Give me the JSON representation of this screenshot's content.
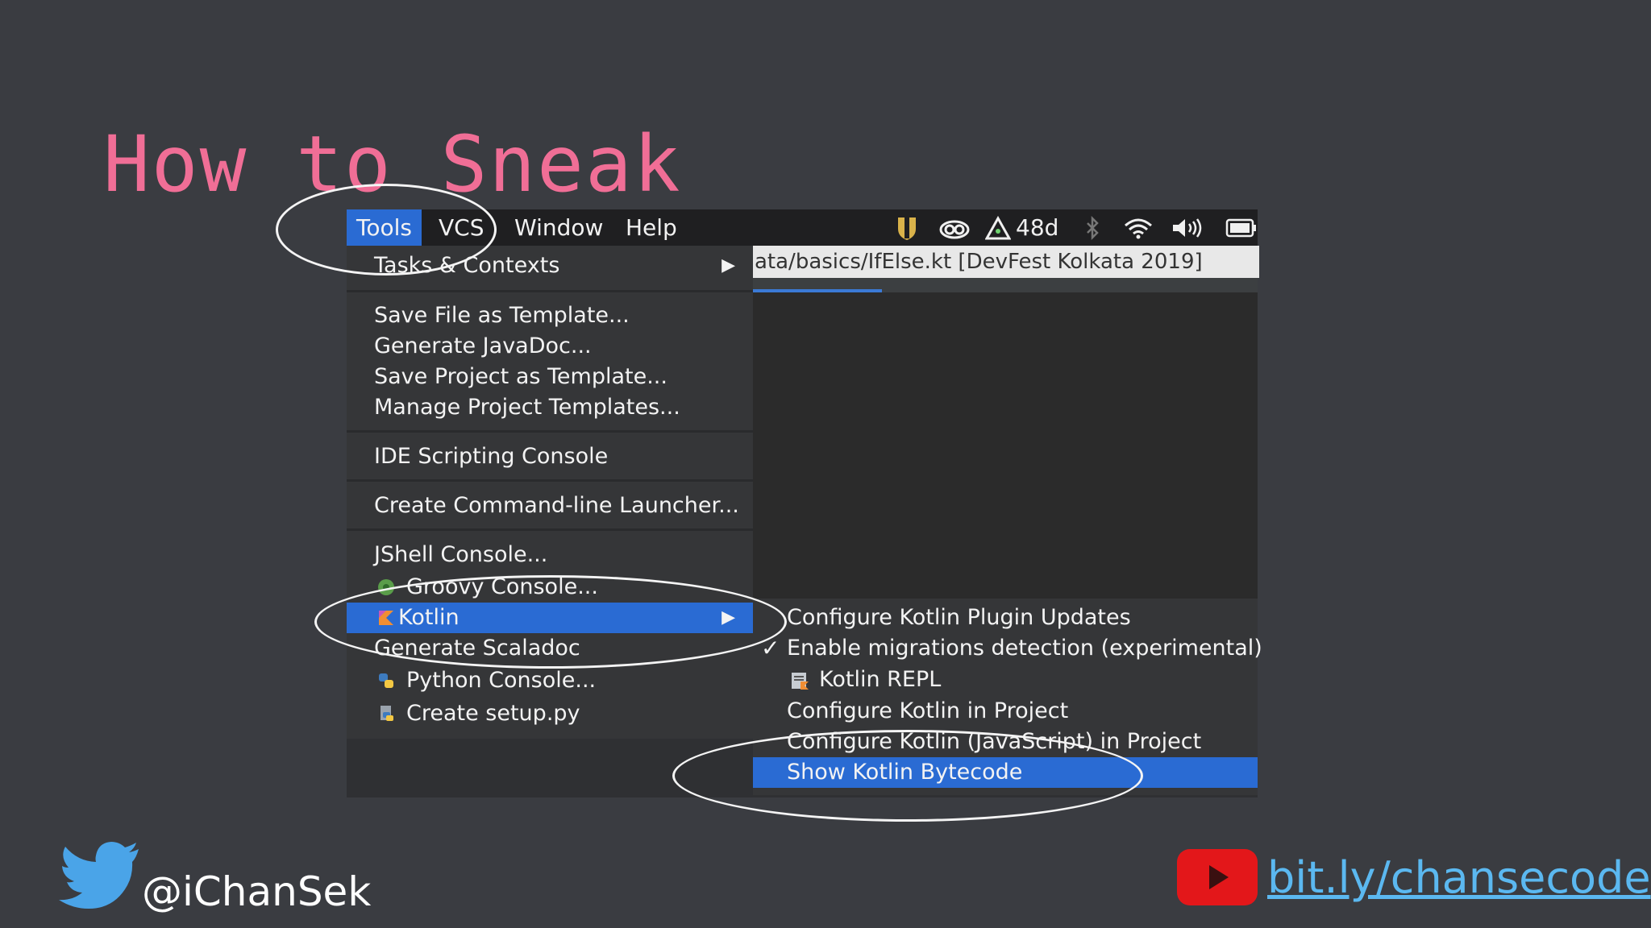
{
  "slide": {
    "title": "How to Sneak"
  },
  "menubar": {
    "items": [
      "Tools",
      "VCS",
      "Window",
      "Help"
    ],
    "active": "Tools",
    "tray_counter": "48d"
  },
  "editor": {
    "path": "ata/basics/IfElse.kt [DevFest Kolkata 2019]"
  },
  "tools_menu": {
    "groups": [
      [
        {
          "label": "Tasks & Contexts",
          "submenu": true
        }
      ],
      [
        {
          "label": "Save File as Template..."
        },
        {
          "label": "Generate JavaDoc..."
        },
        {
          "label": "Save Project as Template..."
        },
        {
          "label": "Manage Project Templates..."
        }
      ],
      [
        {
          "label": "IDE Scripting Console"
        }
      ],
      [
        {
          "label": "Create Command-line Launcher..."
        }
      ],
      [
        {
          "label": "JShell Console..."
        },
        {
          "label": "Groovy Console...",
          "icon": "groovy-icon"
        },
        {
          "label": "Kotlin",
          "icon": "kotlin-icon",
          "submenu": true,
          "highlighted": true
        },
        {
          "label": "Generate Scaladoc"
        },
        {
          "label": "Python Console...",
          "icon": "python-icon"
        },
        {
          "label": "Create setup.py",
          "icon": "python-setup-icon"
        }
      ]
    ],
    "submenu_arrow": "▶"
  },
  "kotlin_submenu": {
    "items": [
      {
        "label": "Configure Kotlin Plugin Updates"
      },
      {
        "label": "Enable migrations detection (experimental)",
        "checked": true
      },
      {
        "label": "Kotlin REPL",
        "icon": "kotlin-repl-icon"
      },
      {
        "label": "Configure Kotlin in Project"
      },
      {
        "label": "Configure Kotlin (JavaScript) in Project"
      },
      {
        "label": "Show Kotlin Bytecode",
        "highlighted": true
      }
    ],
    "check_glyph": "✓"
  },
  "footer": {
    "twitter_handle": "@iChanSek",
    "youtube_link": "bit.ly/chansecode"
  },
  "colors": {
    "background": "#3a3c41",
    "title": "#f06e96",
    "highlight": "#2a6bd3",
    "link": "#5bb8f0",
    "twitter": "#4aa4e8",
    "youtube": "#e3171a"
  }
}
